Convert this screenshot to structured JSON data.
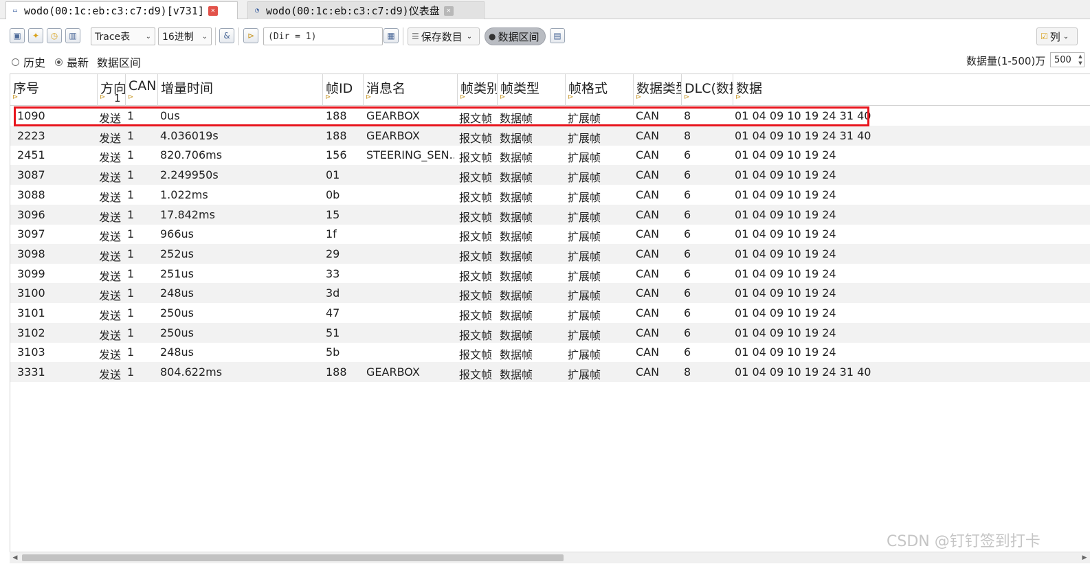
{
  "tabs": [
    {
      "label": "wodo(00:1c:eb:c3:c7:d9)[v731]",
      "icon": "window-icon",
      "active": true
    },
    {
      "label": "wodo(00:1c:eb:c3:c7:d9)仪表盘",
      "icon": "dashboard-icon",
      "active": false
    }
  ],
  "toolbar": {
    "trace_select": "Trace表",
    "radix_select": "16进制",
    "filter_expr": "(Dir = 1)",
    "save_button": "保存数目",
    "range_button": "数据区间",
    "columns_button": "列"
  },
  "filter": {
    "history": "历史",
    "latest": "最新",
    "selected": "latest",
    "range_label": "数据区间",
    "count_label": "数据量(1-500)万",
    "count_value": "500"
  },
  "table": {
    "headers": [
      {
        "key": "seq",
        "label": "序号"
      },
      {
        "key": "dir",
        "label": "方向",
        "sub": "1"
      },
      {
        "key": "can",
        "label": "CAN"
      },
      {
        "key": "delta",
        "label": "增量时间"
      },
      {
        "key": "fid",
        "label": "帧ID"
      },
      {
        "key": "msg",
        "label": "消息名"
      },
      {
        "key": "fcat",
        "label": "帧类别"
      },
      {
        "key": "ftype",
        "label": "帧类型"
      },
      {
        "key": "ffmt",
        "label": "帧格式"
      },
      {
        "key": "dtype",
        "label": "数据类型"
      },
      {
        "key": "dlc",
        "label": "DLC(数据长度)"
      },
      {
        "key": "data",
        "label": "数据"
      }
    ],
    "rows": [
      {
        "seq": "1090",
        "dir": "发送",
        "can": "1",
        "delta": "0us",
        "fid": "188",
        "msg": "GEARBOX",
        "fcat": "报文帧",
        "ftype": "数据帧",
        "ffmt": "扩展帧",
        "dtype": "CAN",
        "dlc": "8",
        "data": "01 04 09 10 19 24 31 40"
      },
      {
        "seq": "2223",
        "dir": "发送",
        "can": "1",
        "delta": "4.036019s",
        "fid": "188",
        "msg": "GEARBOX",
        "fcat": "报文帧",
        "ftype": "数据帧",
        "ffmt": "扩展帧",
        "dtype": "CAN",
        "dlc": "8",
        "data": "01 04 09 10 19 24 31 40"
      },
      {
        "seq": "2451",
        "dir": "发送",
        "can": "1",
        "delta": "820.706ms",
        "fid": "156",
        "msg": "STEERING_SEN...",
        "fcat": "报文帧",
        "ftype": "数据帧",
        "ffmt": "扩展帧",
        "dtype": "CAN",
        "dlc": "6",
        "data": "01 04 09 10 19 24"
      },
      {
        "seq": "3087",
        "dir": "发送",
        "can": "1",
        "delta": "2.249950s",
        "fid": "01",
        "msg": "",
        "fcat": "报文帧",
        "ftype": "数据帧",
        "ffmt": "扩展帧",
        "dtype": "CAN",
        "dlc": "6",
        "data": "01 04 09 10 19 24"
      },
      {
        "seq": "3088",
        "dir": "发送",
        "can": "1",
        "delta": "1.022ms",
        "fid": "0b",
        "msg": "",
        "fcat": "报文帧",
        "ftype": "数据帧",
        "ffmt": "扩展帧",
        "dtype": "CAN",
        "dlc": "6",
        "data": "01 04 09 10 19 24"
      },
      {
        "seq": "3096",
        "dir": "发送",
        "can": "1",
        "delta": "17.842ms",
        "fid": "15",
        "msg": "",
        "fcat": "报文帧",
        "ftype": "数据帧",
        "ffmt": "扩展帧",
        "dtype": "CAN",
        "dlc": "6",
        "data": "01 04 09 10 19 24"
      },
      {
        "seq": "3097",
        "dir": "发送",
        "can": "1",
        "delta": "966us",
        "fid": "1f",
        "msg": "",
        "fcat": "报文帧",
        "ftype": "数据帧",
        "ffmt": "扩展帧",
        "dtype": "CAN",
        "dlc": "6",
        "data": "01 04 09 10 19 24"
      },
      {
        "seq": "3098",
        "dir": "发送",
        "can": "1",
        "delta": "252us",
        "fid": "29",
        "msg": "",
        "fcat": "报文帧",
        "ftype": "数据帧",
        "ffmt": "扩展帧",
        "dtype": "CAN",
        "dlc": "6",
        "data": "01 04 09 10 19 24"
      },
      {
        "seq": "3099",
        "dir": "发送",
        "can": "1",
        "delta": "251us",
        "fid": "33",
        "msg": "",
        "fcat": "报文帧",
        "ftype": "数据帧",
        "ffmt": "扩展帧",
        "dtype": "CAN",
        "dlc": "6",
        "data": "01 04 09 10 19 24"
      },
      {
        "seq": "3100",
        "dir": "发送",
        "can": "1",
        "delta": "248us",
        "fid": "3d",
        "msg": "",
        "fcat": "报文帧",
        "ftype": "数据帧",
        "ffmt": "扩展帧",
        "dtype": "CAN",
        "dlc": "6",
        "data": "01 04 09 10 19 24"
      },
      {
        "seq": "3101",
        "dir": "发送",
        "can": "1",
        "delta": "250us",
        "fid": "47",
        "msg": "",
        "fcat": "报文帧",
        "ftype": "数据帧",
        "ffmt": "扩展帧",
        "dtype": "CAN",
        "dlc": "6",
        "data": "01 04 09 10 19 24"
      },
      {
        "seq": "3102",
        "dir": "发送",
        "can": "1",
        "delta": "250us",
        "fid": "51",
        "msg": "",
        "fcat": "报文帧",
        "ftype": "数据帧",
        "ffmt": "扩展帧",
        "dtype": "CAN",
        "dlc": "6",
        "data": "01 04 09 10 19 24"
      },
      {
        "seq": "3103",
        "dir": "发送",
        "can": "1",
        "delta": "248us",
        "fid": "5b",
        "msg": "",
        "fcat": "报文帧",
        "ftype": "数据帧",
        "ffmt": "扩展帧",
        "dtype": "CAN",
        "dlc": "6",
        "data": "01 04 09 10 19 24"
      },
      {
        "seq": "3331",
        "dir": "发送",
        "can": "1",
        "delta": "804.622ms",
        "fid": "188",
        "msg": "GEARBOX",
        "fcat": "报文帧",
        "ftype": "数据帧",
        "ffmt": "扩展帧",
        "dtype": "CAN",
        "dlc": "8",
        "data": "01 04 09 10 19 24 31 40"
      }
    ],
    "highlighted_row": 0
  },
  "watermark": "CSDN @钉钉签到打卡",
  "colors": {
    "highlight": "#e8141c",
    "tab_close": "#e2524a",
    "row_alt": "#f2f2f2"
  }
}
